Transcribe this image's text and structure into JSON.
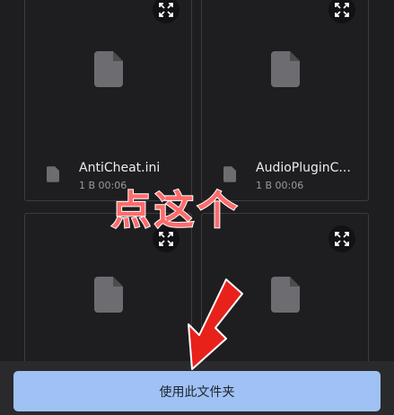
{
  "files": [
    {
      "name": "AntiCheat.ini",
      "meta": "1 B 00:06"
    },
    {
      "name": "AudioPluginC...",
      "meta": "1 B 00:06"
    }
  ],
  "icons": {
    "file": "file-icon",
    "expand": "expand-icon"
  },
  "bottom": {
    "use_folder_label": "使用此文件夹"
  },
  "annotation": {
    "text": "点这个",
    "text_color": "#ff6b6b",
    "arrow_color": "#e8211b"
  },
  "colors": {
    "background": "#1e1e20",
    "button": "#9fc1f4"
  }
}
